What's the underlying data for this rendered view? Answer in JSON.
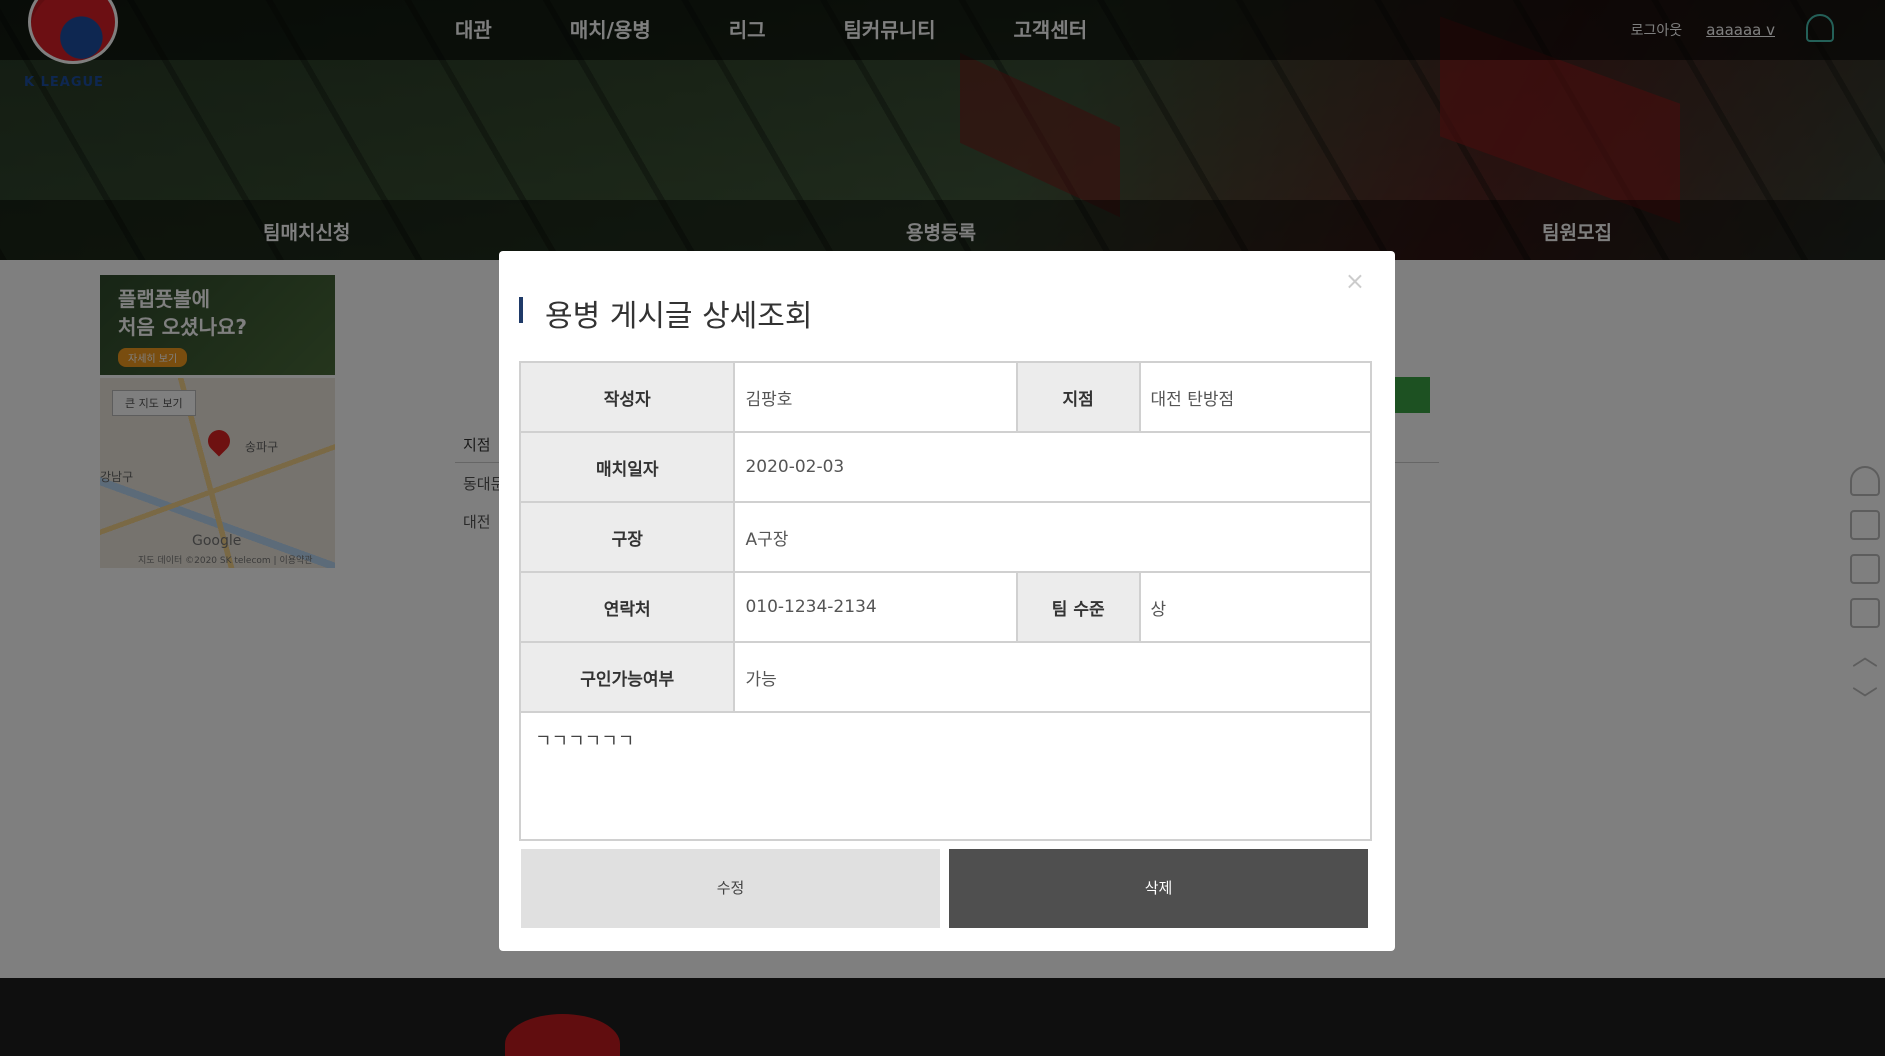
{
  "header": {
    "logo_text": "K LEAGUE",
    "nav": [
      "대관",
      "매치/용병",
      "리그",
      "팀커뮤니티",
      "고객센터"
    ],
    "logout": "로그아웃",
    "user": "aaaaaa v"
  },
  "subnav": [
    "팀매치신청",
    "용병등록",
    "팀원모집"
  ],
  "side_ad": {
    "line1": "플랩풋볼에",
    "line2": "처음 오셨나요?",
    "button": "자세히 보기"
  },
  "map": {
    "big_map": "큰 지도 보기",
    "label_east": "송파구",
    "label_west": "강남구",
    "google": "Google",
    "copyright": "지도 데이터 ©2020 SK telecom | 이용약관"
  },
  "list": {
    "header": "지점",
    "rows": [
      "동대문",
      "대전"
    ]
  },
  "modal": {
    "title": "용병 게시글 상세조회",
    "close": "×",
    "fields": {
      "author_label": "작성자",
      "author_value": "김팡호",
      "branch_label": "지점",
      "branch_value": "대전 탄방점",
      "date_label": "매치일자",
      "date_value": "2020-02-03",
      "stadium_label": "구장",
      "stadium_value": "A구장",
      "contact_label": "연락처",
      "contact_value": "010-1234-2134",
      "level_label": "팀 수준",
      "level_value": "상",
      "recruit_label": "구인가능여부",
      "recruit_value": "가능",
      "content": "ㄱㄱㄱㄱㄱㄱ"
    },
    "edit_button": "수정",
    "delete_button": "삭제"
  }
}
